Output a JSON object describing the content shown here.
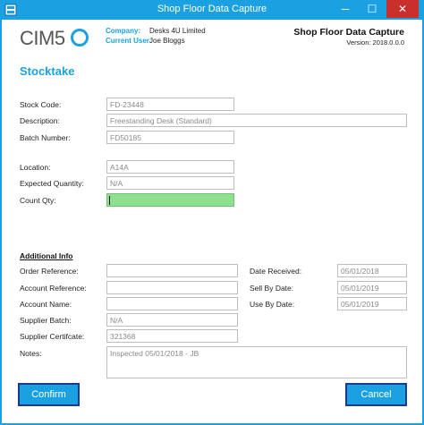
{
  "window": {
    "title": "Shop Floor Data Capture",
    "minimize_glyph": "─",
    "maximize_glyph": "☐",
    "close_glyph": "✕"
  },
  "header": {
    "logo_text": "CIM50",
    "company_label": "Company:",
    "company_value": "Desks 4U Limited",
    "user_label": "Current User:",
    "user_value": "Joe Bloggs",
    "app_title": "Shop Floor Data Capture",
    "version": "Version: 2018.0.0.0"
  },
  "page": {
    "title": "Stocktake"
  },
  "stock": {
    "stock_code_label": "Stock Code:",
    "stock_code_value": "FD-23448",
    "description_label": "Description:",
    "description_value": "Freestanding Desk (Standard)",
    "batch_label": "Batch Number:",
    "batch_value": "FD50185",
    "location_label": "Location:",
    "location_value": "A14A",
    "expected_label": "Expected Quantity:",
    "expected_value": "N/A",
    "count_label": "Count Qty:",
    "count_value": ""
  },
  "additional": {
    "title": "Additional Info",
    "order_ref_label": "Order Reference:",
    "order_ref_value": "",
    "account_ref_label": "Account Reference:",
    "account_ref_value": "",
    "account_name_label": "Account Name:",
    "account_name_value": "",
    "supplier_batch_label": "Supplier Batch:",
    "supplier_batch_value": "N/A",
    "supplier_cert_label": "Supplier Certifcate:",
    "supplier_cert_value": "321368",
    "notes_label": "Notes:",
    "notes_value": "Inspected 05/01/2018 - JB",
    "date_received_label": "Date Received:",
    "date_received_value": "05/01/2018",
    "sell_by_label": "Sell By Date:",
    "sell_by_value": "05/01/2019",
    "use_by_label": "Use By Date:",
    "use_by_value": "05/01/2019"
  },
  "actions": {
    "confirm_label": "Confirm",
    "cancel_label": "Cancel"
  },
  "colors": {
    "accent": "#1ba1e2",
    "active_field": "#8ee08e",
    "close_button": "#c9302c"
  }
}
